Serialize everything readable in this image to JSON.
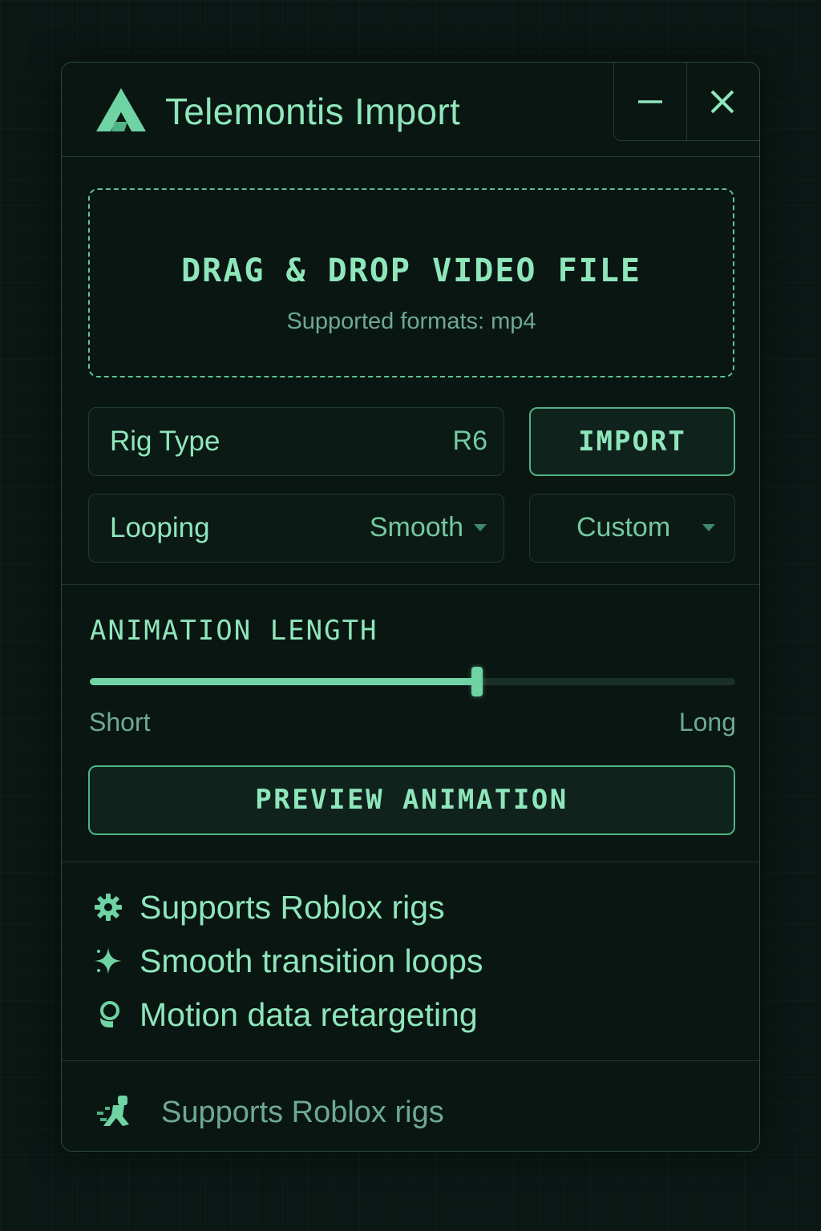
{
  "window": {
    "title": "Telemontis Import",
    "controls": {
      "minimize": "minimize-icon",
      "close": "close-icon"
    }
  },
  "dropzone": {
    "title": "DRAG & DROP VIDEO FILE",
    "subtitle": "Supported formats: mp4"
  },
  "rig_type": {
    "label": "Rig Type",
    "value": "R6"
  },
  "import_button": {
    "label": "IMPORT"
  },
  "looping": {
    "label": "Looping",
    "value": "Smooth"
  },
  "custom": {
    "value": "Custom"
  },
  "animation_length": {
    "title": "ANIMATION LENGTH",
    "min_label": "Short",
    "max_label": "Long",
    "level": 0.6
  },
  "preview_button": {
    "label": "PREVIEW ANIMATION"
  },
  "features": [
    {
      "icon": "gear-icon",
      "text": "Supports Roblox rigs"
    },
    {
      "icon": "sparkle-icon",
      "text": "Smooth transition loops"
    },
    {
      "icon": "head-icon",
      "text": "Motion data retargeting"
    }
  ],
  "footer": {
    "icon": "running-figure-icon",
    "text": "Supports Roblox rigs"
  },
  "colors": {
    "background": "#0b1714",
    "panel": "#0a1612",
    "accent": "#6fd3a4",
    "text": "#8fe6bb",
    "muted_text": "#6ea994",
    "border": "#223f35"
  }
}
